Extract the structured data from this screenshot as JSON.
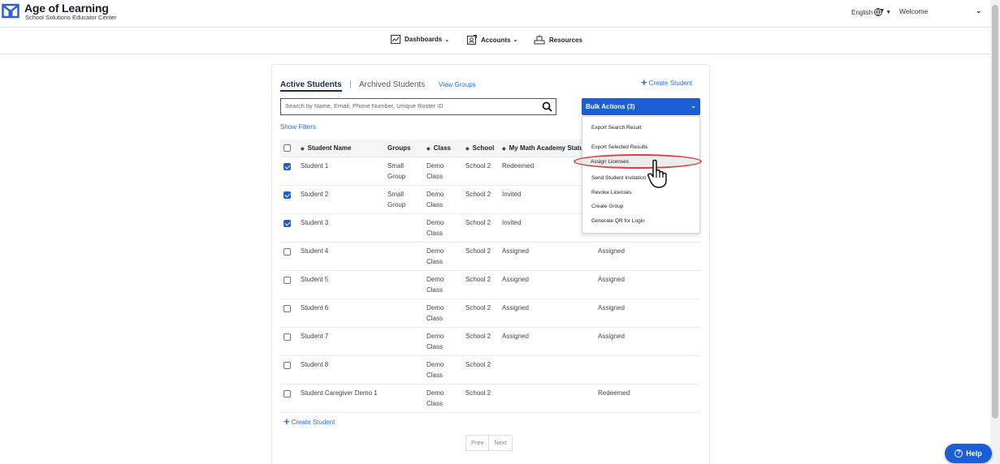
{
  "header": {
    "logo_title": "Age of Learning",
    "logo_subtitle": "School Solutions Educator Center",
    "language": "English",
    "welcome": "Welcome"
  },
  "nav": {
    "dashboards": "Dashboards",
    "accounts": "Accounts",
    "resources": "Resources"
  },
  "tabs": {
    "active": "Active Students",
    "separator": "|",
    "archived": "Archived Students",
    "view_groups": "View Groups"
  },
  "actions": {
    "create_student": "Create Student",
    "bulk_actions": "Bulk Actions (3)",
    "show_filters": "Show Filters"
  },
  "search": {
    "placeholder": "Search by Name, Email, Phone Number, Unique Roster ID",
    "value": ""
  },
  "table": {
    "headers": [
      "Student Name",
      "Groups",
      "Class",
      "School",
      "My Math Academy Status"
    ],
    "rows": [
      {
        "checked": true,
        "name": "Student 1",
        "group1": "Small",
        "group2": "Group",
        "class1": "Demo",
        "class2": "Class",
        "school": "School 2",
        "status": "Redeemed",
        "extra": ""
      },
      {
        "checked": true,
        "name": "Student 2",
        "group1": "Small",
        "group2": "Group",
        "class1": "Demo",
        "class2": "Class",
        "school": "School 2",
        "status": "Invited",
        "extra": ""
      },
      {
        "checked": true,
        "name": "Student 3",
        "group1": "",
        "group2": "",
        "class1": "Demo",
        "class2": "Class",
        "school": "School 2",
        "status": "Invited",
        "extra": ""
      },
      {
        "checked": false,
        "name": "Student 4",
        "group1": "",
        "group2": "",
        "class1": "Demo",
        "class2": "Class",
        "school": "School 2",
        "status": "Assigned",
        "extra": "Assigned"
      },
      {
        "checked": false,
        "name": "Student 5",
        "group1": "",
        "group2": "",
        "class1": "Demo",
        "class2": "Class",
        "school": "School 2",
        "status": "Assigned",
        "extra": "Assigned"
      },
      {
        "checked": false,
        "name": "Student 6",
        "group1": "",
        "group2": "",
        "class1": "Demo",
        "class2": "Class",
        "school": "School 2",
        "status": "Assigned",
        "extra": "Assigned"
      },
      {
        "checked": false,
        "name": "Student 7",
        "group1": "",
        "group2": "",
        "class1": "Demo",
        "class2": "Class",
        "school": "School 2",
        "status": "Assigned",
        "extra": "Assigned"
      },
      {
        "checked": false,
        "name": "Student 8",
        "group1": "",
        "group2": "",
        "class1": "Demo",
        "class2": "Class",
        "school": "School 2",
        "status": "",
        "extra": ""
      },
      {
        "checked": false,
        "name": "Student Caregiver Demo 1",
        "group1": "",
        "group2": "",
        "class1": "Demo",
        "class2": "Class",
        "school": "School 2",
        "status": "",
        "extra": "Redeemed"
      }
    ]
  },
  "bulk_menu": {
    "items": [
      "Export Search Result",
      "Export Selected Results",
      "Assign Licenses",
      "Send Student Invitation",
      "Revoke Licenses",
      "Create Group",
      "Generate QR for Login"
    ],
    "highlighted_index": 2
  },
  "pager": {
    "prev": "Prev",
    "next": "Next"
  },
  "help": {
    "label": "Help"
  },
  "colors": {
    "primary": "#1a5fd8",
    "link": "#2d6fd6",
    "highlight_ring": "#d94040"
  }
}
